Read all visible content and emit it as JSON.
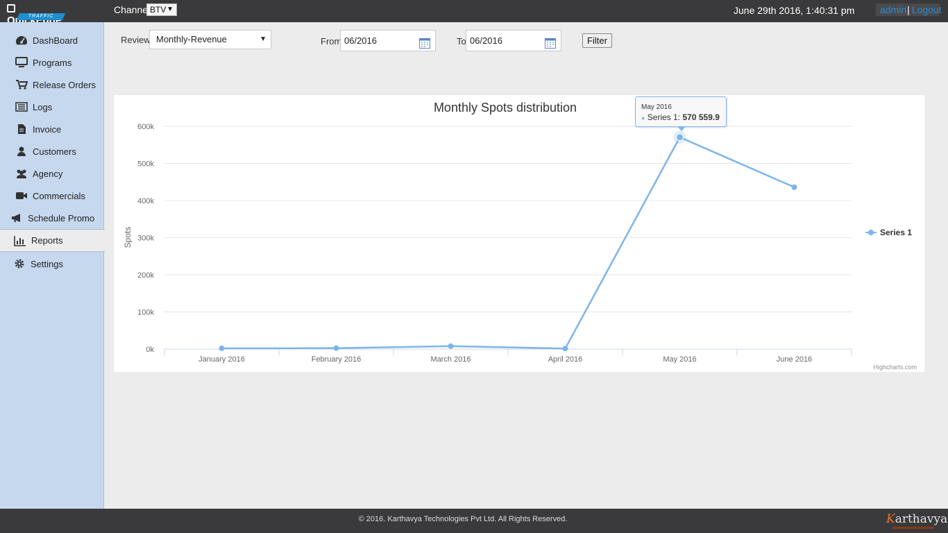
{
  "header": {
    "logo_text": "QuickEdge",
    "logo_sub": "TRAFFIC",
    "channel_label": "Channel",
    "channel_value": "BTV",
    "datetime": "June 29th 2016, 1:40:31 pm",
    "user_link": "admin",
    "separator": "|",
    "logout_link": "Logout"
  },
  "sidebar": {
    "items": [
      {
        "label": "DashBoard",
        "icon": "dashboard-icon"
      },
      {
        "label": "Programs",
        "icon": "monitor-icon"
      },
      {
        "label": "Release Orders",
        "icon": "cart-icon"
      },
      {
        "label": "Logs",
        "icon": "list-icon"
      },
      {
        "label": "Invoice",
        "icon": "file-icon"
      },
      {
        "label": "Customers",
        "icon": "user-icon"
      },
      {
        "label": "Agency",
        "icon": "users-icon"
      },
      {
        "label": "Commercials",
        "icon": "video-camera-icon"
      },
      {
        "label": "Schedule Promo",
        "icon": "megaphone-icon"
      },
      {
        "label": "Reports",
        "icon": "bar-chart-icon",
        "active": true
      },
      {
        "label": "Settings",
        "icon": "gear-icon"
      }
    ]
  },
  "filters": {
    "review_label": "Review",
    "review_value": "Monthly-Revenue",
    "from_label": "From",
    "from_value": "06/2016",
    "to_label": "To",
    "to_value": "06/2016",
    "filter_button": "Filter"
  },
  "tooltip": {
    "header": "May 2016",
    "series": "Series 1:",
    "value": "570 559.9"
  },
  "chart_data": {
    "type": "line",
    "title": "Monthly Spots distribution",
    "ylabel": "Spots",
    "xlabel": "",
    "categories": [
      "January 2016",
      "February 2016",
      "March 2016",
      "April 2016",
      "May 2016",
      "June 2016"
    ],
    "series": [
      {
        "name": "Series 1",
        "values": [
          2000,
          2500,
          8000,
          1500,
          570559.9,
          436000
        ]
      }
    ],
    "yticks": [
      "0k",
      "100k",
      "200k",
      "300k",
      "400k",
      "500k",
      "600k"
    ],
    "ylim": [
      0,
      600000
    ],
    "grid": true,
    "legend": "right",
    "credits": "Highcharts.com",
    "colors": {
      "series": "#7cb5ec"
    }
  },
  "footer": {
    "copyright": "© 2016. Karthavya Technologies Pvt Ltd. All Rights Reserved.",
    "brand_k": "K",
    "brand_rest": "arthavya"
  }
}
